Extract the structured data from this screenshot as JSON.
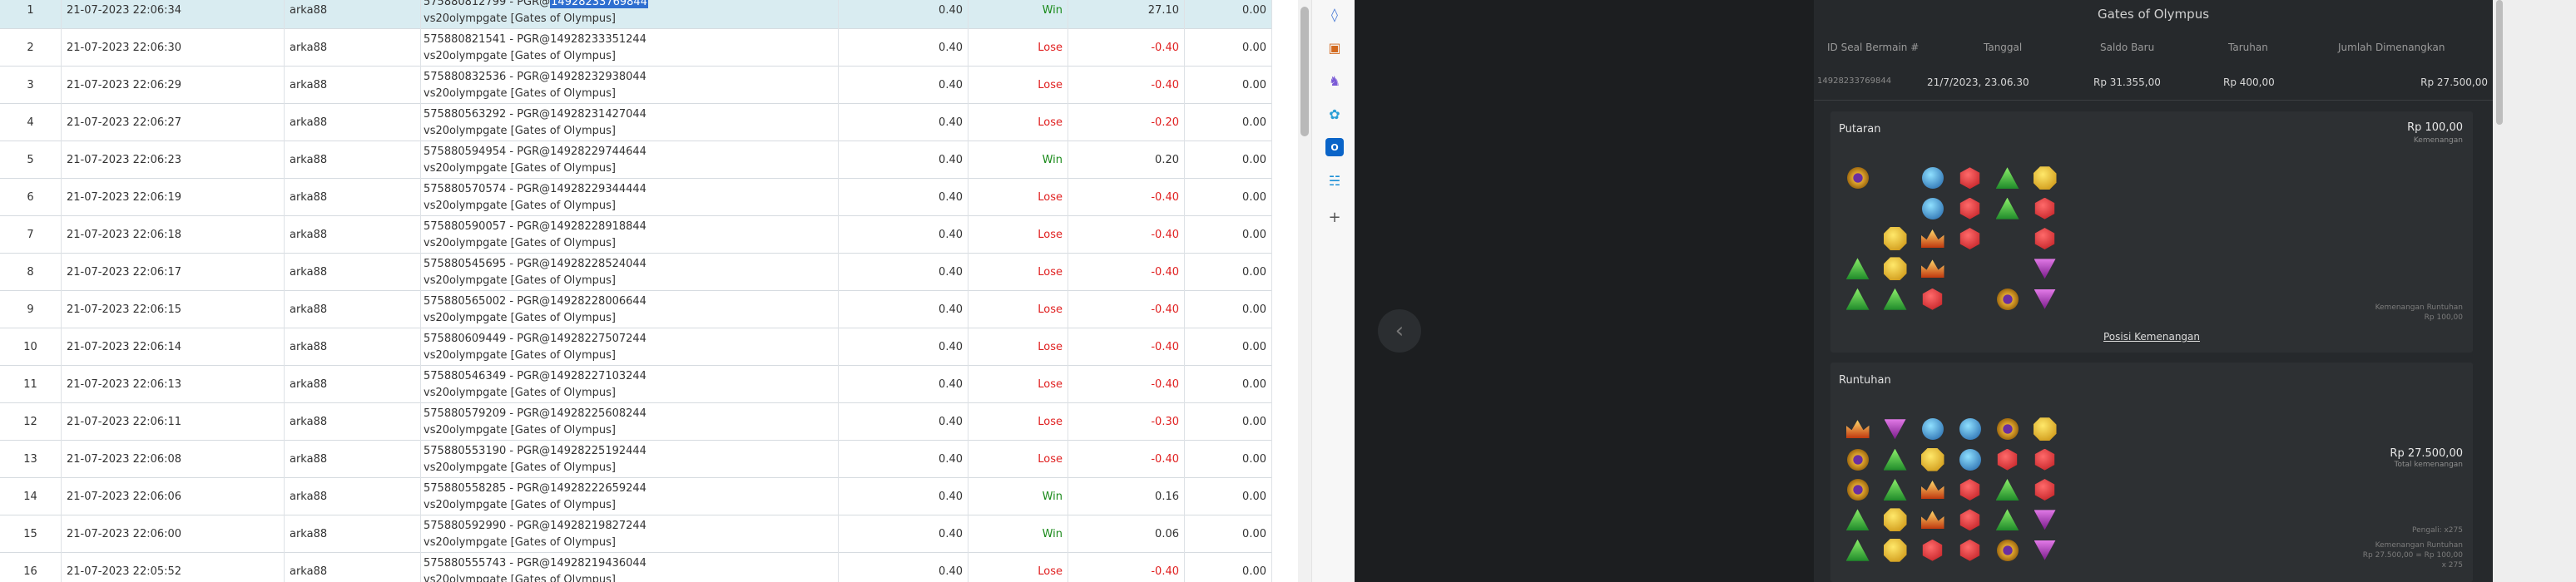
{
  "table": {
    "rows": [
      {
        "no": "1",
        "date": "21-07-2023 22:06:34",
        "user": "arka88",
        "id_prefix": "575880812799 - PGR@",
        "id_num": "14928233769844",
        "game": "vs20olympgate [Gates of Olympus]",
        "bet": "0.40",
        "result": "Win",
        "win": "27.10",
        "jackpot": "0.00",
        "selected": true
      },
      {
        "no": "2",
        "date": "21-07-2023 22:06:30",
        "user": "arka88",
        "id_prefix": "575880821541 - PGR@",
        "id_num": "14928233351244",
        "game": "vs20olympgate [Gates of Olympus]",
        "bet": "0.40",
        "result": "Lose",
        "win": "-0.40",
        "jackpot": "0.00"
      },
      {
        "no": "3",
        "date": "21-07-2023 22:06:29",
        "user": "arka88",
        "id_prefix": "575880832536 - PGR@",
        "id_num": "14928232938044",
        "game": "vs20olympgate [Gates of Olympus]",
        "bet": "0.40",
        "result": "Lose",
        "win": "-0.40",
        "jackpot": "0.00"
      },
      {
        "no": "4",
        "date": "21-07-2023 22:06:27",
        "user": "arka88",
        "id_prefix": "575880563292 - PGR@",
        "id_num": "14928231427044",
        "game": "vs20olympgate [Gates of Olympus]",
        "bet": "0.40",
        "result": "Lose",
        "win": "-0.20",
        "jackpot": "0.00"
      },
      {
        "no": "5",
        "date": "21-07-2023 22:06:23",
        "user": "arka88",
        "id_prefix": "575880594954 - PGR@",
        "id_num": "14928229744644",
        "game": "vs20olympgate [Gates of Olympus]",
        "bet": "0.40",
        "result": "Win",
        "win": "0.20",
        "jackpot": "0.00"
      },
      {
        "no": "6",
        "date": "21-07-2023 22:06:19",
        "user": "arka88",
        "id_prefix": "575880570574 - PGR@",
        "id_num": "14928229344444",
        "game": "vs20olympgate [Gates of Olympus]",
        "bet": "0.40",
        "result": "Lose",
        "win": "-0.40",
        "jackpot": "0.00"
      },
      {
        "no": "7",
        "date": "21-07-2023 22:06:18",
        "user": "arka88",
        "id_prefix": "575880590057 - PGR@",
        "id_num": "14928228918844",
        "game": "vs20olympgate [Gates of Olympus]",
        "bet": "0.40",
        "result": "Lose",
        "win": "-0.40",
        "jackpot": "0.00"
      },
      {
        "no": "8",
        "date": "21-07-2023 22:06:17",
        "user": "arka88",
        "id_prefix": "575880545695 - PGR@",
        "id_num": "14928228524044",
        "game": "vs20olympgate [Gates of Olympus]",
        "bet": "0.40",
        "result": "Lose",
        "win": "-0.40",
        "jackpot": "0.00"
      },
      {
        "no": "9",
        "date": "21-07-2023 22:06:15",
        "user": "arka88",
        "id_prefix": "575880565002 - PGR@",
        "id_num": "14928228006644",
        "game": "vs20olympgate [Gates of Olympus]",
        "bet": "0.40",
        "result": "Lose",
        "win": "-0.40",
        "jackpot": "0.00"
      },
      {
        "no": "10",
        "date": "21-07-2023 22:06:14",
        "user": "arka88",
        "id_prefix": "575880609449 - PGR@",
        "id_num": "14928227507244",
        "game": "vs20olympgate [Gates of Olympus]",
        "bet": "0.40",
        "result": "Lose",
        "win": "-0.40",
        "jackpot": "0.00"
      },
      {
        "no": "11",
        "date": "21-07-2023 22:06:13",
        "user": "arka88",
        "id_prefix": "575880546349 - PGR@",
        "id_num": "14928227103244",
        "game": "vs20olympgate [Gates of Olympus]",
        "bet": "0.40",
        "result": "Lose",
        "win": "-0.40",
        "jackpot": "0.00"
      },
      {
        "no": "12",
        "date": "21-07-2023 22:06:11",
        "user": "arka88",
        "id_prefix": "575880579209 - PGR@",
        "id_num": "14928225608244",
        "game": "vs20olympgate [Gates of Olympus]",
        "bet": "0.40",
        "result": "Lose",
        "win": "-0.30",
        "jackpot": "0.00"
      },
      {
        "no": "13",
        "date": "21-07-2023 22:06:08",
        "user": "arka88",
        "id_prefix": "575880553190 - PGR@",
        "id_num": "14928225192444",
        "game": "vs20olympgate [Gates of Olympus]",
        "bet": "0.40",
        "result": "Lose",
        "win": "-0.40",
        "jackpot": "0.00"
      },
      {
        "no": "14",
        "date": "21-07-2023 22:06:06",
        "user": "arka88",
        "id_prefix": "575880558285 - PGR@",
        "id_num": "14928222659244",
        "game": "vs20olympgate [Gates of Olympus]",
        "bet": "0.40",
        "result": "Win",
        "win": "0.16",
        "jackpot": "0.00"
      },
      {
        "no": "15",
        "date": "21-07-2023 22:06:00",
        "user": "arka88",
        "id_prefix": "575880592990 - PGR@",
        "id_num": "14928219827244",
        "game": "vs20olympgate [Gates of Olympus]",
        "bet": "0.40",
        "result": "Win",
        "win": "0.06",
        "jackpot": "0.00"
      },
      {
        "no": "16",
        "date": "21-07-2023 22:05:52",
        "user": "arka88",
        "id_prefix": "575880555743 - PGR@",
        "id_num": "14928219436044",
        "game": "vs20olympgate [Gates of Olympus]",
        "bet": "0.40",
        "result": "Lose",
        "win": "-0.40",
        "jackpot": "0.00"
      }
    ]
  },
  "sidebar": {
    "icons": [
      "tag-icon",
      "briefcase-icon",
      "chess-icon",
      "copilot-icon",
      "outlook-icon",
      "shopping-icon",
      "plus-icon"
    ]
  },
  "modal": {
    "title": "Gates of Olympus",
    "headers": {
      "id": "ID Seal Bermain #",
      "date": "Tanggal",
      "balance": "Saldo Baru",
      "bet": "Taruhan",
      "win": "Jumlah Dimenangkan"
    },
    "values": {
      "id": "14928233769844",
      "date": "21/7/2023, 23.06.30",
      "balance": "Rp 31.355,00",
      "bet": "Rp 400,00",
      "win": "Rp 27.500,00"
    },
    "spin_card": {
      "title": "Putaran",
      "amount": "Rp 100,00",
      "amount_label": "Kemenangan",
      "note_line1": "Kemenangan Runtuhan",
      "note_line2": "Rp 100,00",
      "link": "Posisi Kemenangan",
      "grid": [
        [
          "ring",
          "empty",
          "blue",
          "red",
          "green",
          "yellow"
        ],
        [
          "empty",
          "empty",
          "blue",
          "red",
          "green",
          "red"
        ],
        [
          "empty",
          "yellow",
          "crown",
          "red",
          "empty",
          "red"
        ],
        [
          "green",
          "yellow",
          "crown",
          "empty",
          "empty",
          "purple"
        ],
        [
          "green",
          "green",
          "red",
          "empty",
          "ring",
          "purple"
        ]
      ]
    },
    "tumble_card": {
      "title": "Runtuhan",
      "amount": "Rp 27.500,00",
      "amount_label": "Total kemenangan",
      "note_multiplier": "Pengali: x275",
      "note_line1": "Kemenangan Runtuhan",
      "note_line2": "Rp 27.500,00 = Rp 100,00",
      "note_line3": "x 275",
      "grid": [
        [
          "crown",
          "purple",
          "blue",
          "blue",
          "ring",
          "yellow"
        ],
        [
          "ring",
          "green",
          "yellow",
          "blue",
          "red",
          "red"
        ],
        [
          "ring",
          "green",
          "crown",
          "red",
          "green",
          "red"
        ],
        [
          "green",
          "yellow",
          "crown",
          "red",
          "green",
          "purple"
        ],
        [
          "green",
          "yellow",
          "red",
          "red",
          "ring",
          "purple"
        ]
      ]
    }
  },
  "colors": {
    "win": "#1a8a1a",
    "lose": "#e02020",
    "selected_row": "#d9ecf1",
    "modal_bg": "#26292c"
  }
}
